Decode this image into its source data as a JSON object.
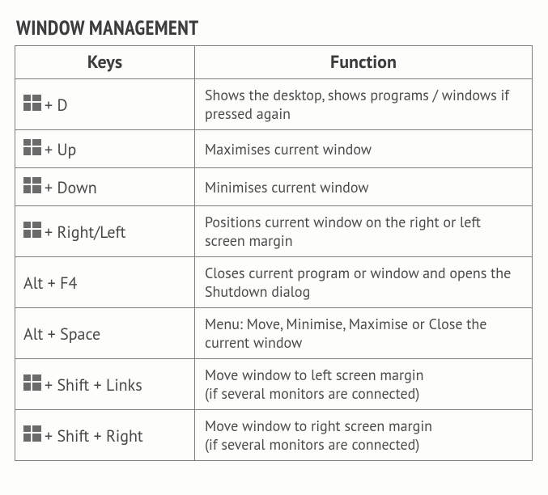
{
  "title": "WINDOW MANAGEMENT",
  "headers": {
    "keys": "Keys",
    "function": "Function"
  },
  "rows": [
    {
      "icon": "win",
      "keys": "+ D",
      "func": "Shows the desktop, shows programs / windows if pressed again"
    },
    {
      "icon": "win",
      "keys": "+ Up",
      "func": "Maximises current window"
    },
    {
      "icon": "win",
      "keys": "+ Down",
      "func": "Minimises current window"
    },
    {
      "icon": "win",
      "keys": "+ Right/Left",
      "func": "Positions current window on the right or left screen margin"
    },
    {
      "icon": "",
      "keys": "Alt + F4",
      "func": "Closes current program or window and opens the Shutdown dialog"
    },
    {
      "icon": "",
      "keys": "Alt + Space",
      "func": "Menu: Move, Minimise, Maximise or Close the current window"
    },
    {
      "icon": "win",
      "keys": "+ Shift + Links",
      "func": "Move window to left screen margin\n(if several monitors are connected)"
    },
    {
      "icon": "win",
      "keys": "+ Shift + Right",
      "func": "Move window to right screen margin\n(if several monitors are connected)"
    }
  ]
}
